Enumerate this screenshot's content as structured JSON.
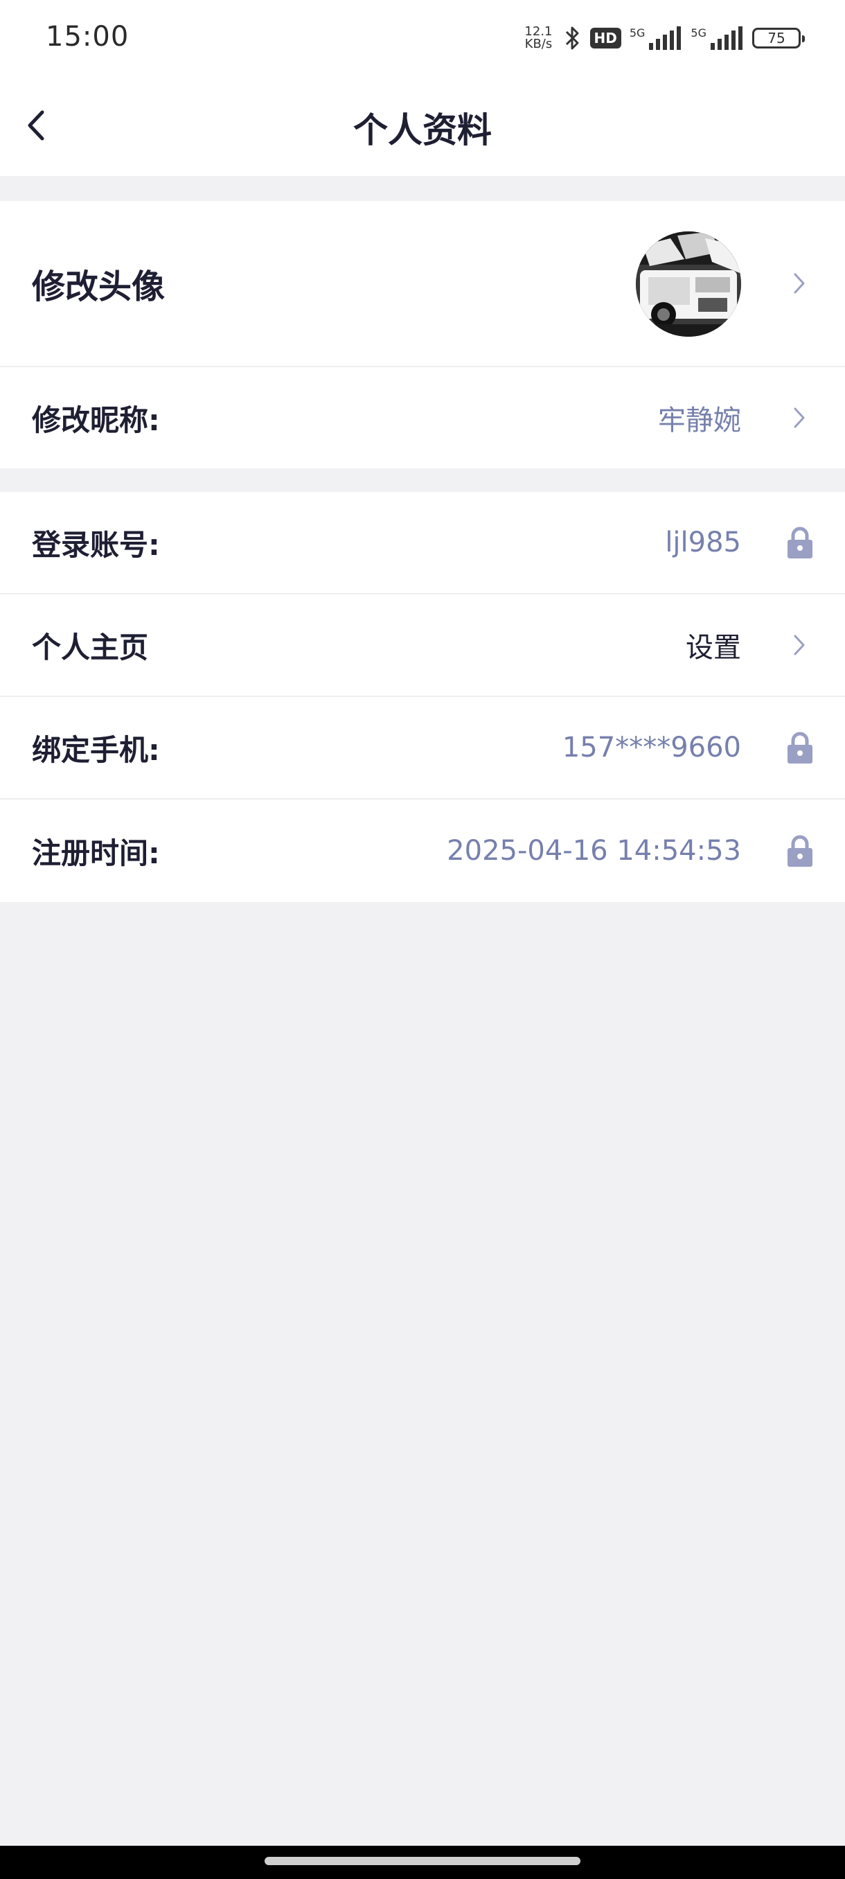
{
  "status": {
    "time": "15:00",
    "speed_value": "12.1",
    "speed_unit": "KB/s",
    "hd_label": "HD",
    "sim1_label": "5G",
    "sim2_label": "5G",
    "battery": "75"
  },
  "header": {
    "title": "个人资料"
  },
  "profile": {
    "avatar_label": "修改头像",
    "nickname_label": "修改昵称:",
    "nickname_value": "牢静婉",
    "account_label": "登录账号:",
    "account_value": "ljl985",
    "homepage_label": "个人主页",
    "homepage_value": "设置",
    "phone_label": "绑定手机:",
    "phone_value": "157****9660",
    "register_label": "注册时间:",
    "register_value": "2025-04-16 14:54:53"
  },
  "colors": {
    "accent_text": "#7680ad",
    "lock_icon": "#9a9fc4",
    "background": "#f1f1f3"
  },
  "icons": {
    "back": "chevron-left-icon",
    "chevron": "chevron-right-icon",
    "lock": "lock-icon",
    "bluetooth": "bluetooth-icon"
  }
}
